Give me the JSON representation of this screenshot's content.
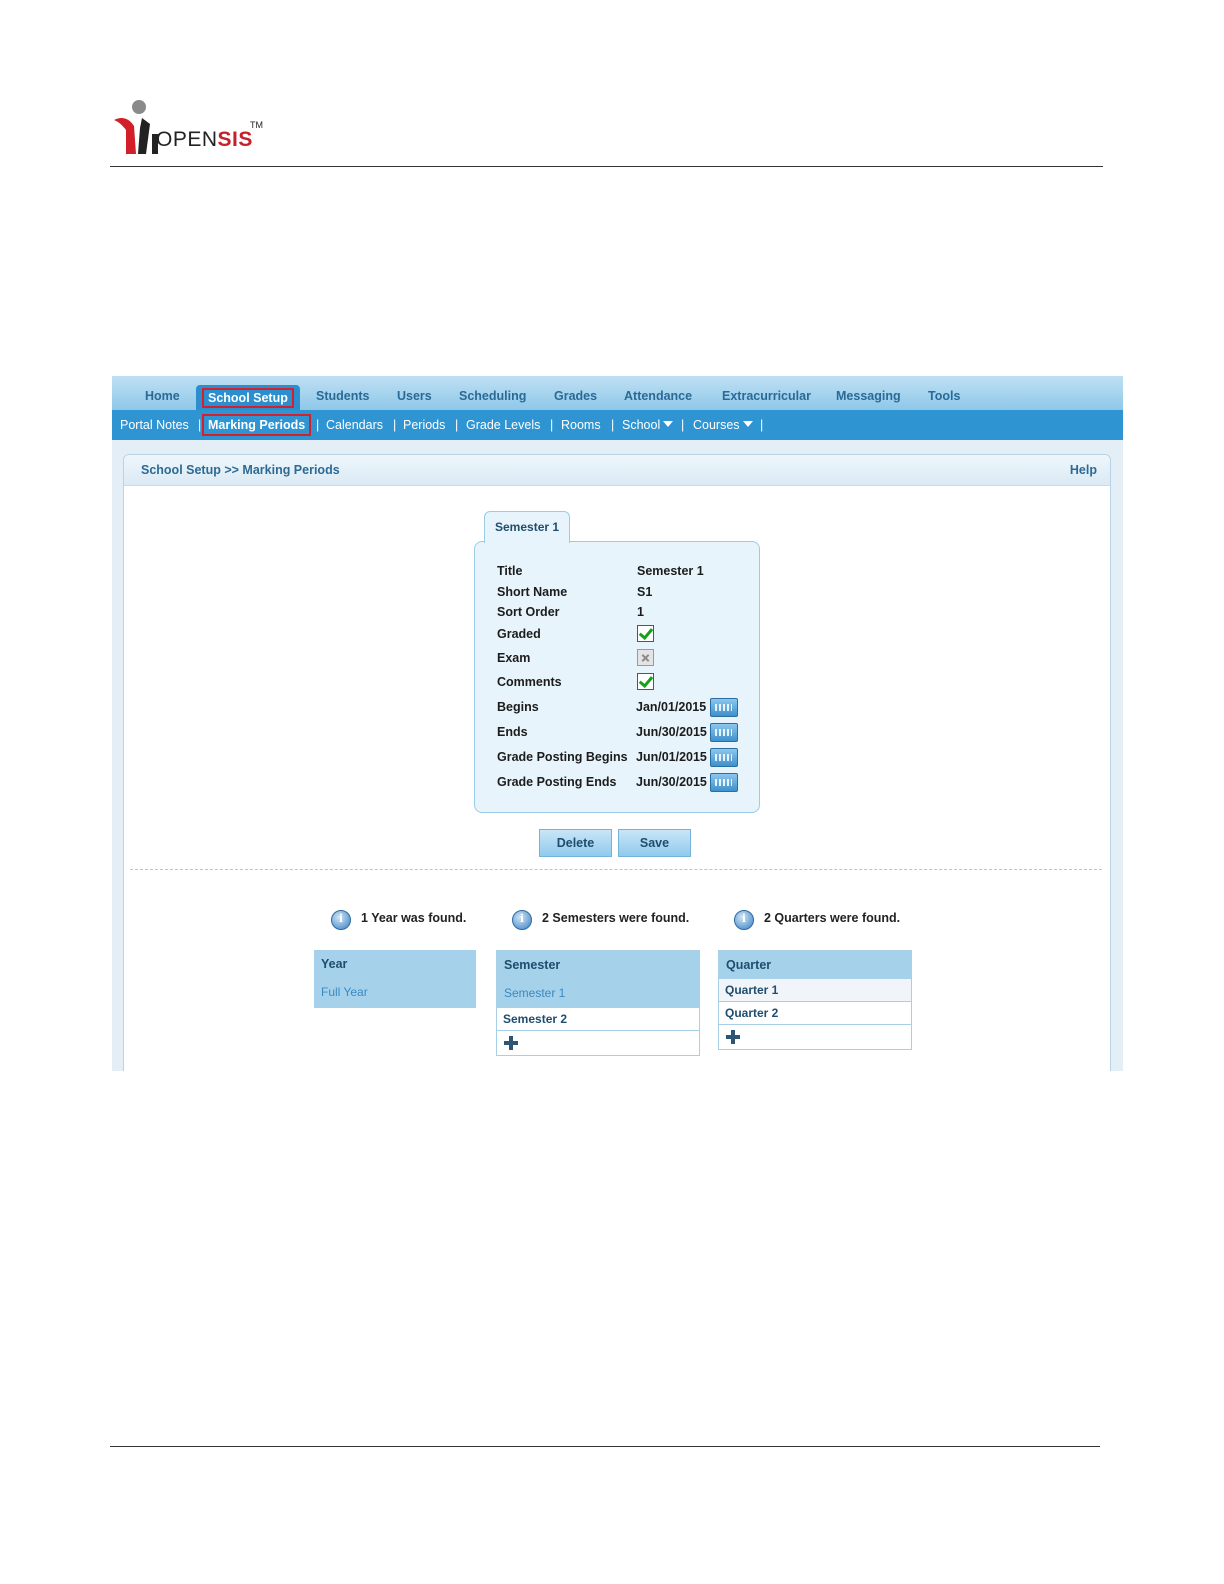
{
  "logo": {
    "word_open": "OPEN",
    "word_sis": "SIS",
    "tm": "TM"
  },
  "topnav": {
    "tabs": [
      {
        "label": "Home"
      },
      {
        "label": "School Setup"
      },
      {
        "label": "Students"
      },
      {
        "label": "Users"
      },
      {
        "label": "Scheduling"
      },
      {
        "label": "Grades"
      },
      {
        "label": "Attendance"
      },
      {
        "label": "Extracurricular"
      },
      {
        "label": "Messaging"
      },
      {
        "label": "Tools"
      }
    ]
  },
  "subnav": {
    "items": [
      {
        "label": "Portal Notes"
      },
      {
        "label": "Marking Periods"
      },
      {
        "label": "Calendars"
      },
      {
        "label": "Periods"
      },
      {
        "label": "Grade Levels"
      },
      {
        "label": "Rooms"
      },
      {
        "label": "School"
      },
      {
        "label": "Courses"
      }
    ],
    "separator": "|"
  },
  "panel": {
    "breadcrumb": "School Setup >> Marking Periods",
    "help": "Help"
  },
  "form": {
    "tab_label": "Semester 1",
    "fields": {
      "title": {
        "label": "Title",
        "value": "Semester 1"
      },
      "short_name": {
        "label": "Short Name",
        "value": "S1"
      },
      "sort_order": {
        "label": "Sort Order",
        "value": "1"
      },
      "graded": {
        "label": "Graded",
        "checked": true
      },
      "exam": {
        "label": "Exam",
        "checked": false
      },
      "comments": {
        "label": "Comments",
        "checked": true
      },
      "begins": {
        "label": "Begins",
        "value": "Jan/01/2015"
      },
      "ends": {
        "label": "Ends",
        "value": "Jun/30/2015"
      },
      "grade_posting_begins": {
        "label": "Grade Posting Begins",
        "value": "Jun/01/2015"
      },
      "grade_posting_ends": {
        "label": "Grade Posting Ends",
        "value": "Jun/30/2015"
      }
    },
    "delete_label": "Delete",
    "save_label": "Save"
  },
  "lists": {
    "year": {
      "found": "1 Year was found.",
      "header": "Year",
      "rows": [
        "Full Year"
      ]
    },
    "semester": {
      "found": "2 Semesters were found.",
      "header": "Semester",
      "rows": [
        "Semester 1",
        "Semester 2"
      ]
    },
    "quarter": {
      "found": "2 Quarters were found.",
      "header": "Quarter",
      "rows": [
        "Quarter 1",
        "Quarter 2"
      ]
    }
  }
}
